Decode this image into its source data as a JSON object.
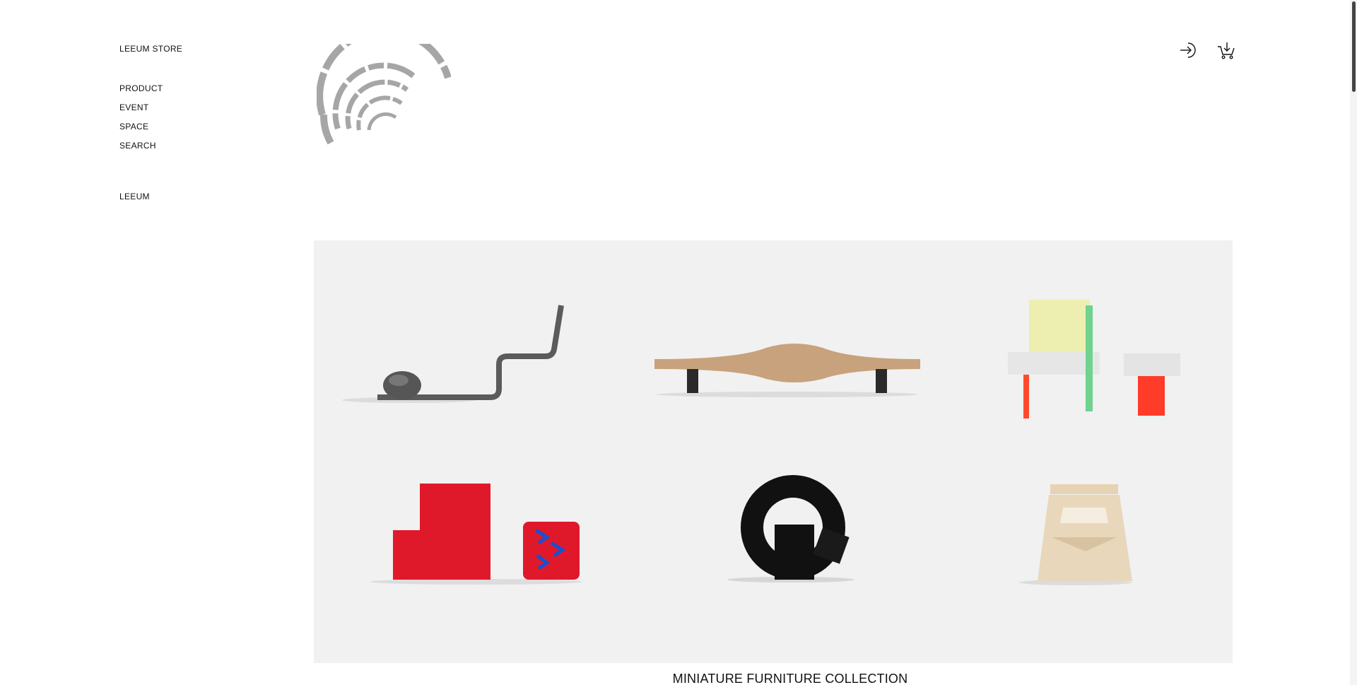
{
  "sidebar": {
    "brand": "LEEUM STORE",
    "nav": [
      "PRODUCT",
      "EVENT",
      "SPACE",
      "SEARCH"
    ],
    "secondary": "LEEUM"
  },
  "header": {
    "icons": [
      "login-icon",
      "cart-icon"
    ]
  },
  "hero": {
    "caption": "MINIATURE FURNITURE COLLECTION"
  },
  "colors": {
    "background": "#ffffff",
    "hero_bg": "#f1f1f1",
    "logo_gray": "#a6a6a6",
    "text": "#111111"
  }
}
